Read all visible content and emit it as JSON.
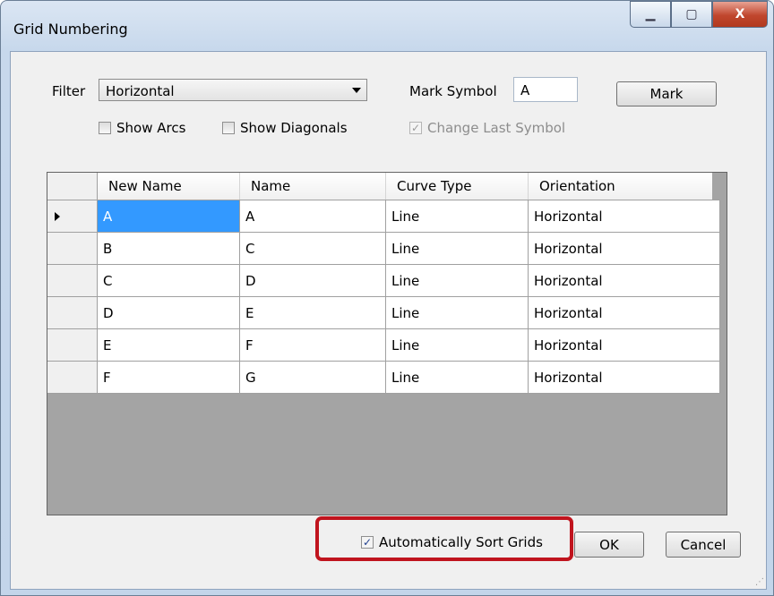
{
  "window": {
    "title": "Grid Numbering",
    "minimize_glyph": "▁",
    "maximize_glyph": "▢",
    "close_glyph": "X"
  },
  "filter": {
    "label": "Filter",
    "selected": "Horizontal"
  },
  "options": {
    "show_arcs": "Show Arcs",
    "show_diagonals": "Show Diagonals",
    "change_last_symbol": "Change Last Symbol"
  },
  "mark_symbol": {
    "label": "Mark Symbol",
    "value": "A"
  },
  "buttons": {
    "mark": "Mark",
    "ok": "OK",
    "cancel": "Cancel"
  },
  "auto_sort": {
    "label": "Automatically Sort Grids",
    "checked": true
  },
  "grid": {
    "columns": [
      "New Name",
      "Name",
      "Curve Type",
      "Orientation"
    ],
    "rows": [
      [
        "A",
        "A",
        "Line",
        "Horizontal"
      ],
      [
        "B",
        "C",
        "Line",
        "Horizontal"
      ],
      [
        "C",
        "D",
        "Line",
        "Horizontal"
      ],
      [
        "D",
        "E",
        "Line",
        "Horizontal"
      ],
      [
        "E",
        "F",
        "Line",
        "Horizontal"
      ],
      [
        "F",
        "G",
        "Line",
        "Horizontal"
      ]
    ]
  },
  "colors": {
    "selection": "#3399ff",
    "highlight": "#c0141e"
  }
}
